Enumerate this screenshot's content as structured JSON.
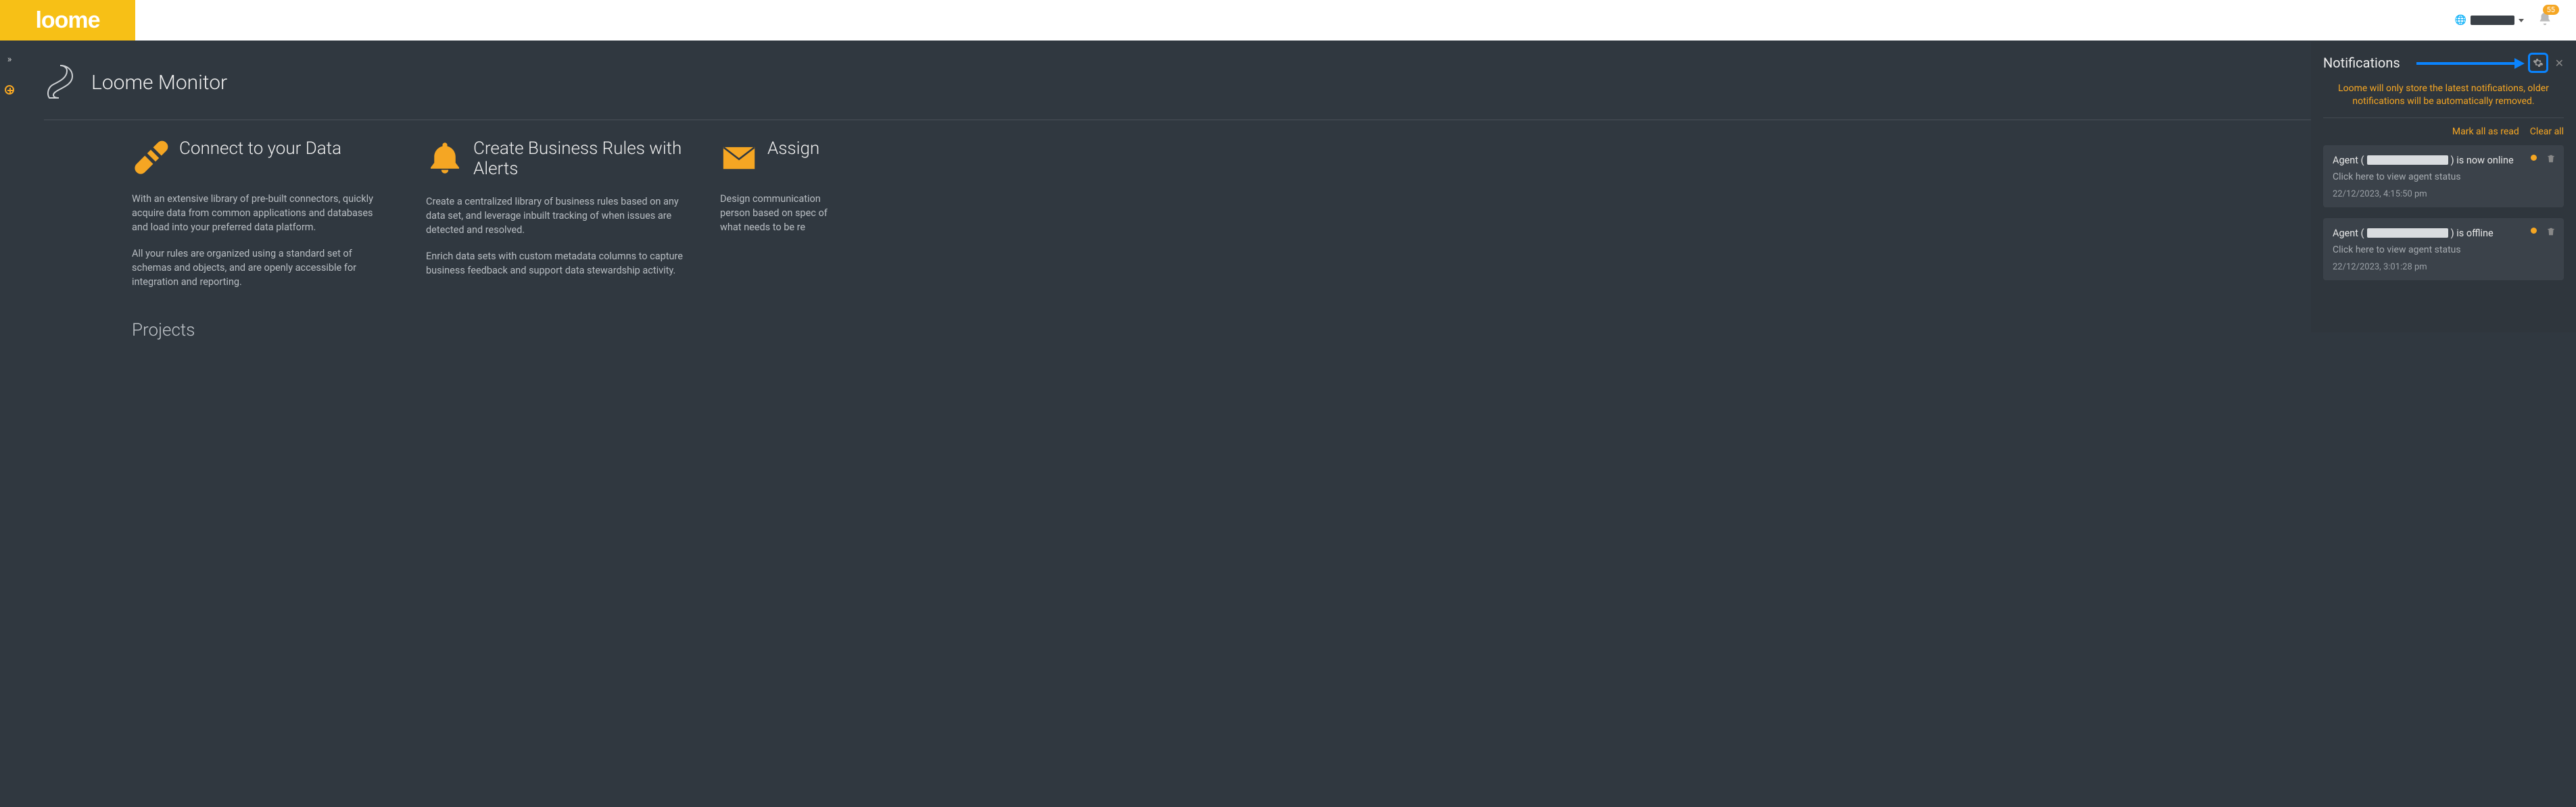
{
  "topbar": {
    "logo_text": "loome",
    "notification_badge": "55"
  },
  "page": {
    "title": "Loome Monitor",
    "projects_heading": "Projects"
  },
  "cards": [
    {
      "title": "Connect to your Data",
      "p1": "With an extensive library of pre-built connectors, quickly acquire data from common applications and databases and load into your preferred data platform.",
      "p2": "All your rules are organized using a standard set of schemas and objects, and are openly accessible for integration and reporting."
    },
    {
      "title": "Create Business Rules with Alerts",
      "p1": "Create a centralized library of business rules based on any data set, and leverage inbuilt tracking of when issues are detected and resolved.",
      "p2": "Enrich data sets with custom metadata columns to capture business feedback and support data stewardship activity."
    },
    {
      "title": "Assign",
      "p1": "Design communication person based on spec of what needs to be re",
      "p2": ""
    }
  ],
  "notifications": {
    "title": "Notifications",
    "retention_msg": "Loome will only store the latest notifications, older notifications will be automatically removed.",
    "mark_all": "Mark all as read",
    "clear_all": "Clear all",
    "items": [
      {
        "prefix": "Agent (",
        "suffix": ") is now online",
        "sub": "Click here to view agent status",
        "time": "22/12/2023, 4:15:50 pm"
      },
      {
        "prefix": "Agent (",
        "suffix": ") is offline",
        "sub": "Click here to view agent status",
        "time": "22/12/2023, 3:01:28 pm"
      }
    ]
  }
}
